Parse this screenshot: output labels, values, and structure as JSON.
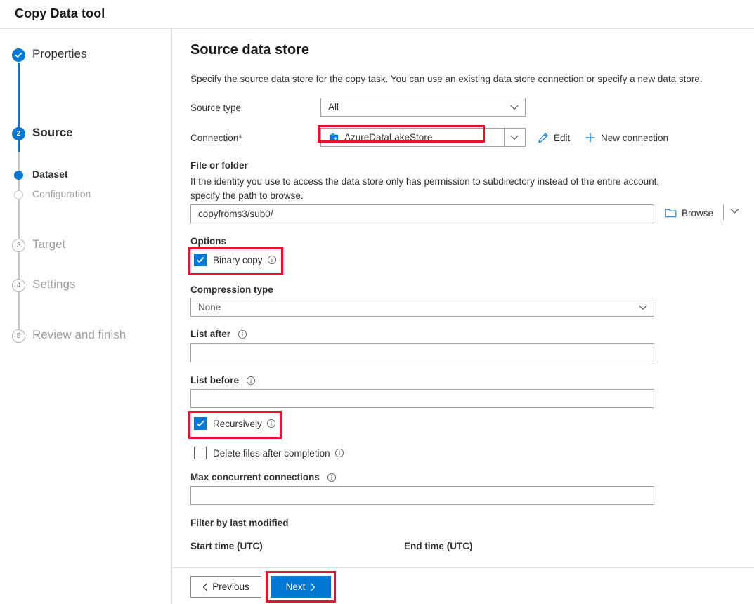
{
  "window": {
    "title": "Copy Data tool"
  },
  "colors": {
    "accent": "#0078d4",
    "highlight": "#e8112d",
    "muted_text": "#a19f9d",
    "border": "#a19f9d"
  },
  "sidebar": {
    "steps": [
      {
        "label": "Properties",
        "marker": "check-icon",
        "state": "completed"
      },
      {
        "label": "Source",
        "marker": "2",
        "state": "current"
      },
      {
        "label": "Dataset",
        "marker": "filled-dot-icon",
        "state": "current-sub"
      },
      {
        "label": "Configuration",
        "marker": "hollow-dot-icon",
        "state": "upcoming-sub"
      },
      {
        "label": "Target",
        "marker": "3",
        "state": "upcoming"
      },
      {
        "label": "Settings",
        "marker": "4",
        "state": "upcoming"
      },
      {
        "label": "Review and finish",
        "marker": "5",
        "state": "upcoming"
      }
    ]
  },
  "main": {
    "heading": "Source data store",
    "description": "Specify the source data store for the copy task. You can use an existing data store connection or specify a new data store.",
    "source_type": {
      "label": "Source type",
      "value": "All",
      "chevron": "chevron-down-icon"
    },
    "connection": {
      "label": "Connection",
      "required_mark": "*",
      "value": "AzureDataLakeStore",
      "icon": "azure-data-lake-store-icon",
      "chevron": "chevron-down-icon",
      "edit_label": "Edit",
      "edit_icon": "pencil-icon",
      "new_connection_label": "New connection",
      "new_connection_icon": "plus-icon",
      "highlighted": true
    },
    "file_or_folder": {
      "label": "File or folder",
      "helper": "If the identity you use to access the data store only has permission to subdirectory instead of the entire account, specify the path to browse.",
      "value": "copyfroms3/sub0/",
      "browse_label": "Browse",
      "browse_icon": "folder-icon",
      "browse_chevron": "chevron-down-icon"
    },
    "options": {
      "label": "Options",
      "binary_copy": {
        "label": "Binary copy",
        "checked": true,
        "info_icon": "info-icon",
        "highlighted": true
      }
    },
    "compression_type": {
      "label": "Compression type",
      "value": "None",
      "chevron": "chevron-down-icon"
    },
    "list_after": {
      "label": "List after",
      "value": "",
      "info_icon": "info-icon"
    },
    "list_before": {
      "label": "List before",
      "value": "",
      "info_icon": "info-icon"
    },
    "recursively": {
      "label": "Recursively",
      "checked": true,
      "info_icon": "info-icon",
      "highlighted": true
    },
    "delete_files": {
      "label": "Delete files after completion",
      "checked": false,
      "info_icon": "info-icon"
    },
    "max_concurrent_connections": {
      "label": "Max concurrent connections",
      "value": "",
      "info_icon": "info-icon"
    },
    "filter_by_last_modified": {
      "label": "Filter by last modified",
      "start_time_label": "Start time (UTC)",
      "end_time_label": "End time (UTC)"
    }
  },
  "footer": {
    "previous_label": "Previous",
    "previous_chevron": "chevron-left-icon",
    "next_label": "Next",
    "next_chevron": "chevron-right-icon",
    "next_highlighted": true
  }
}
